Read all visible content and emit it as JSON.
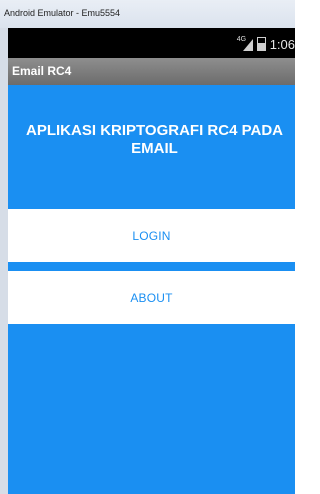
{
  "window": {
    "title": "Android Emulator - Emu5554"
  },
  "status_bar": {
    "network": "4G",
    "time": "1:06"
  },
  "action_bar": {
    "title": "Email RC4"
  },
  "main": {
    "heading_line1": "APLIKASI KRIPTOGRAFI RC4 PADA",
    "heading_line2": "EMAIL",
    "login_label": "LOGIN",
    "about_label": "ABOUT"
  },
  "colors": {
    "primary_blue": "#1a8ff2",
    "status_bar": "#000000",
    "action_bar": "#7d7d7d",
    "button_bg": "#ffffff"
  },
  "icons": [
    "signal-icon",
    "battery-icon"
  ]
}
